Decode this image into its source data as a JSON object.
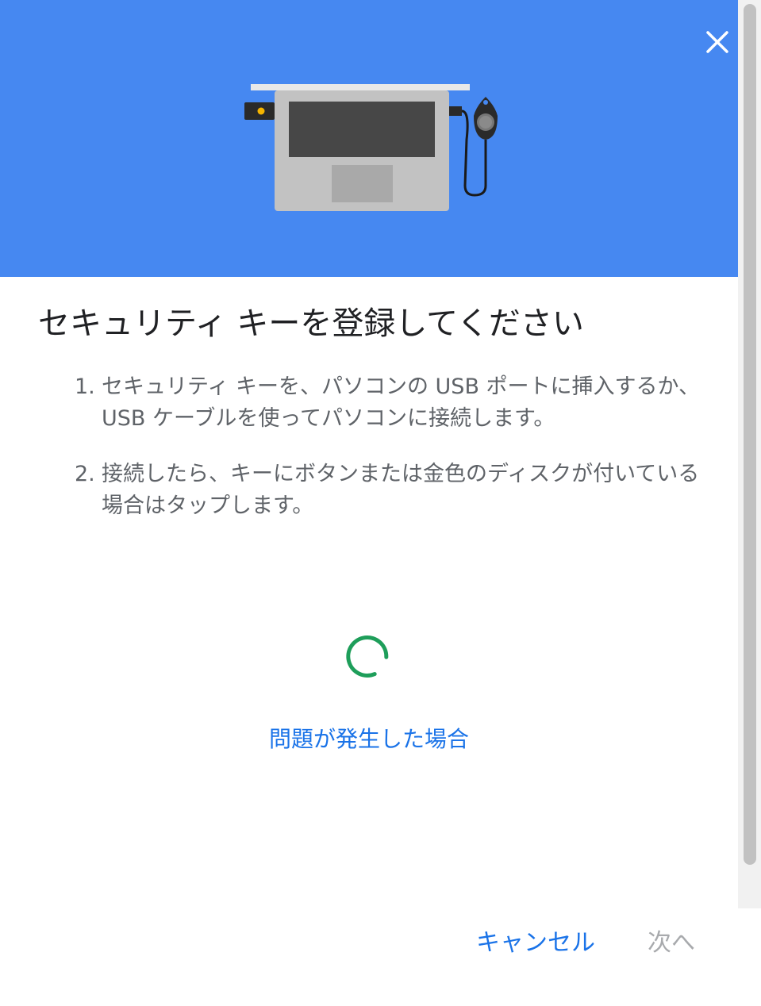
{
  "dialog": {
    "title": "セキュリティ キーを登録してください",
    "steps": [
      {
        "number": "1.",
        "text": "セキュリティ キーを、パソコンの USB ポートに挿入するか、USB ケーブルを使ってパソコンに接続します。"
      },
      {
        "number": "2.",
        "text": "接続したら、キーにボタンまたは金色のディスクが付いている場合はタップします。"
      }
    ],
    "trouble_link": "問題が発生した場合",
    "cancel_label": "キャンセル",
    "next_label": "次へ",
    "icons": {
      "close": "close-icon",
      "spinner": "loading-spinner-icon",
      "illustration": "laptop-security-key-illustration"
    }
  },
  "colors": {
    "header_bg": "#4688f1",
    "link": "#1a73e8",
    "spinner": "#1e9e5a",
    "disabled": "#a8aaad"
  }
}
